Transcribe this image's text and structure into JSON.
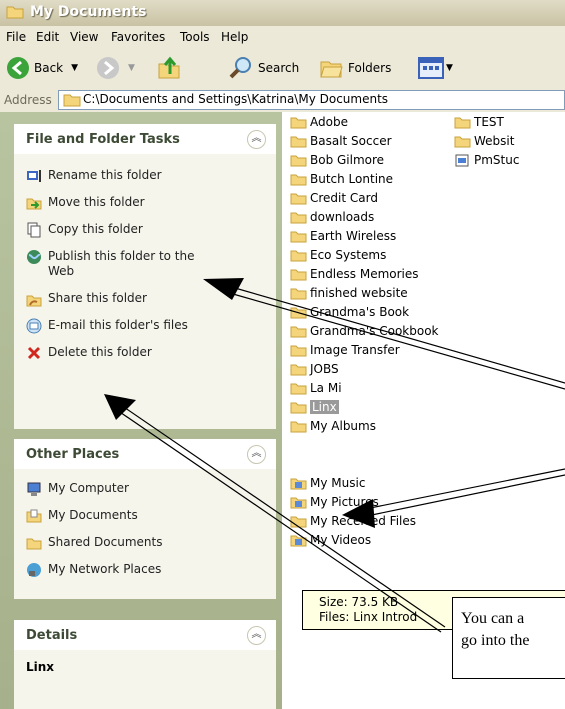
{
  "window": {
    "title": "My Documents"
  },
  "menu": [
    "File",
    "Edit",
    "View",
    "Favorites",
    "Tools",
    "Help"
  ],
  "toolbar": {
    "back": "Back",
    "search": "Search",
    "folders": "Folders"
  },
  "address": {
    "label": "Address",
    "path": "C:\\Documents and Settings\\Katrina\\My Documents"
  },
  "tasks": {
    "title": "File and Folder Tasks",
    "items": [
      {
        "label": "Rename this folder",
        "icon": "rename-icon"
      },
      {
        "label": "Move this folder",
        "icon": "move-icon"
      },
      {
        "label": "Copy this folder",
        "icon": "copy-icon"
      },
      {
        "label": "Publish this folder to the",
        "label2": "Web",
        "icon": "publish-icon"
      },
      {
        "label": "Share this folder",
        "icon": "share-icon"
      },
      {
        "label": "E-mail this folder's files",
        "icon": "email-icon"
      },
      {
        "label": "Delete this folder",
        "icon": "delete-icon"
      }
    ]
  },
  "places": {
    "title": "Other Places",
    "items": [
      {
        "label": "My Computer",
        "icon": "computer-icon"
      },
      {
        "label": "My Documents",
        "icon": "documents-icon"
      },
      {
        "label": "Shared Documents",
        "icon": "folder-icon"
      },
      {
        "label": "My Network Places",
        "icon": "network-icon"
      }
    ]
  },
  "details": {
    "title": "Details",
    "name": "Linx"
  },
  "files_col1": [
    "Adobe",
    "Basalt Soccer",
    "Bob Gilmore",
    "Butch Lontine",
    "Credit Card",
    "downloads",
    "Earth Wireless",
    "Eco Systems",
    "Endless Memories",
    "finished website",
    "Grandma's Book",
    "Grandma's Cookbook",
    "Image Transfer",
    "JOBS",
    "La Mi",
    "Linx",
    "My Albums",
    "",
    "",
    "My Music",
    "My Pictures",
    "My Received Files",
    "My Videos"
  ],
  "files_col2": [
    "TEST",
    "Websit",
    "PmStuc"
  ],
  "tooltip": {
    "size": "Size: 73.5 KB",
    "files": "Files: Linx Introd"
  },
  "callout": {
    "line1": "You can a",
    "line2": "go into the"
  },
  "colors": {
    "titlebar": "#c9c2a3",
    "taskpane": "#a6b08a",
    "selected": "#9a9a9a"
  }
}
